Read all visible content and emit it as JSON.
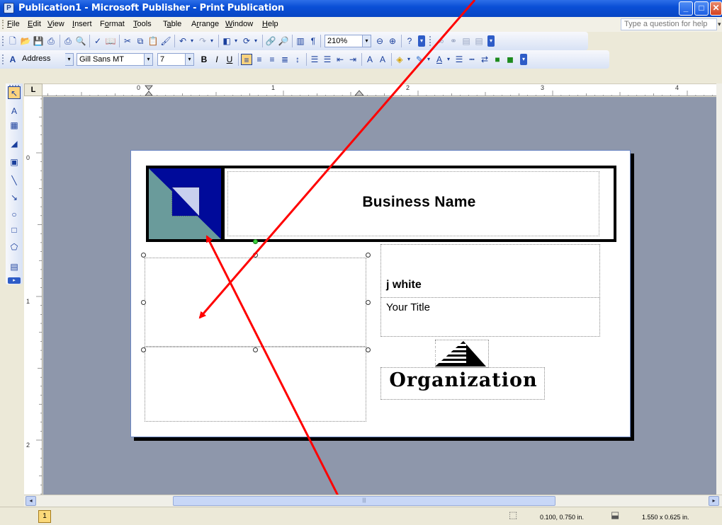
{
  "window": {
    "title": "Publication1 - Microsoft Publisher - Print Publication",
    "minimize_glyph": "_",
    "maximize_glyph": "□",
    "close_glyph": "✕"
  },
  "menu": {
    "items": [
      {
        "label": "File",
        "accel": "F"
      },
      {
        "label": "Edit",
        "accel": "E"
      },
      {
        "label": "View",
        "accel": "V"
      },
      {
        "label": "Insert",
        "accel": "I"
      },
      {
        "label": "Format",
        "accel": "o"
      },
      {
        "label": "Tools",
        "accel": "T"
      },
      {
        "label": "Table",
        "accel": "a"
      },
      {
        "label": "Arrange",
        "accel": "r"
      },
      {
        "label": "Window",
        "accel": "W"
      },
      {
        "label": "Help",
        "accel": "H"
      }
    ],
    "help_placeholder": "Type a question for help"
  },
  "toolbar_standard": {
    "zoom_value": "210%"
  },
  "toolbar_formatting": {
    "style_value": "Address",
    "font_value": "Gill Sans MT",
    "size_value": "7"
  },
  "ruler": {
    "horizontal_labels": [
      "0",
      "1",
      "2",
      "3",
      "4"
    ],
    "vertical_labels": [
      "0",
      "1",
      "2"
    ],
    "corner_label": "L"
  },
  "card": {
    "business_name": "Business Name",
    "person_name": "j white",
    "person_title": "Your Title",
    "organization": "Organization"
  },
  "status": {
    "page_number": "1",
    "position": "0.100, 0.750 in.",
    "size": "1.550 x 0.625 in."
  },
  "colors": {
    "logo_dark": "#000a9a",
    "logo_light": "#6a9b9b",
    "annotation_arrow": "#ff0000",
    "workspace": "#8e97ab"
  }
}
